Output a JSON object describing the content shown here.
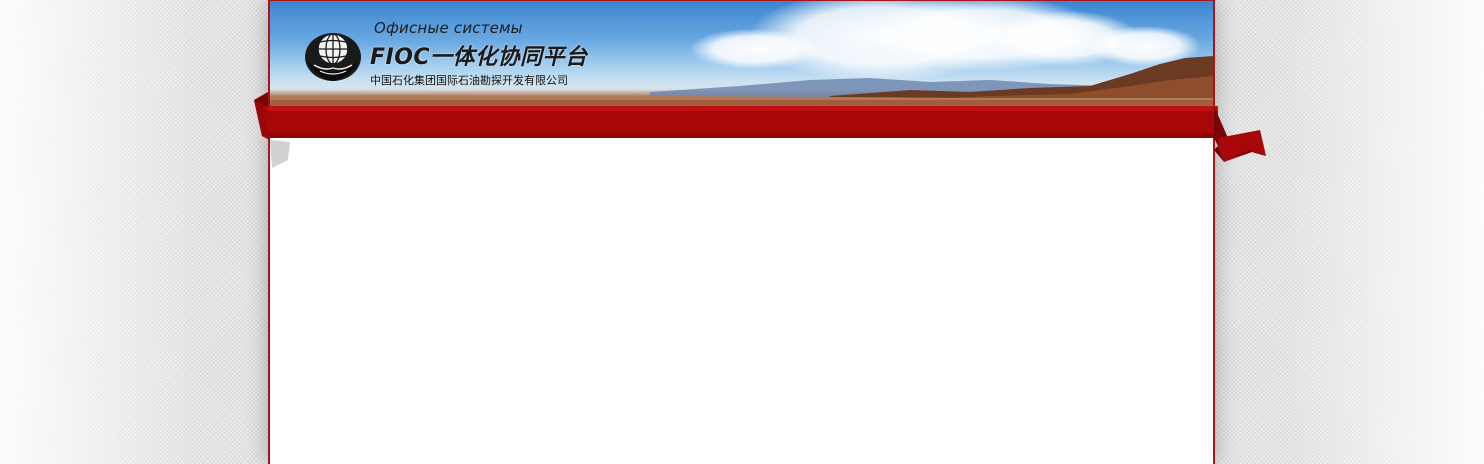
{
  "header": {
    "subtitle_ru": "Офисные системы",
    "title": "FIOC一体化协同平台",
    "company": "中国石化集团国际石油勘探开发有限公司"
  },
  "icons": {
    "logo": "globe-icon"
  },
  "colors": {
    "ribbon": "#a8070a",
    "ribbon_dark": "#7a0507",
    "frame_border": "#a8141a",
    "sky_top": "#3c86cf",
    "background": "#ebebeb",
    "content": "#ffffff"
  }
}
